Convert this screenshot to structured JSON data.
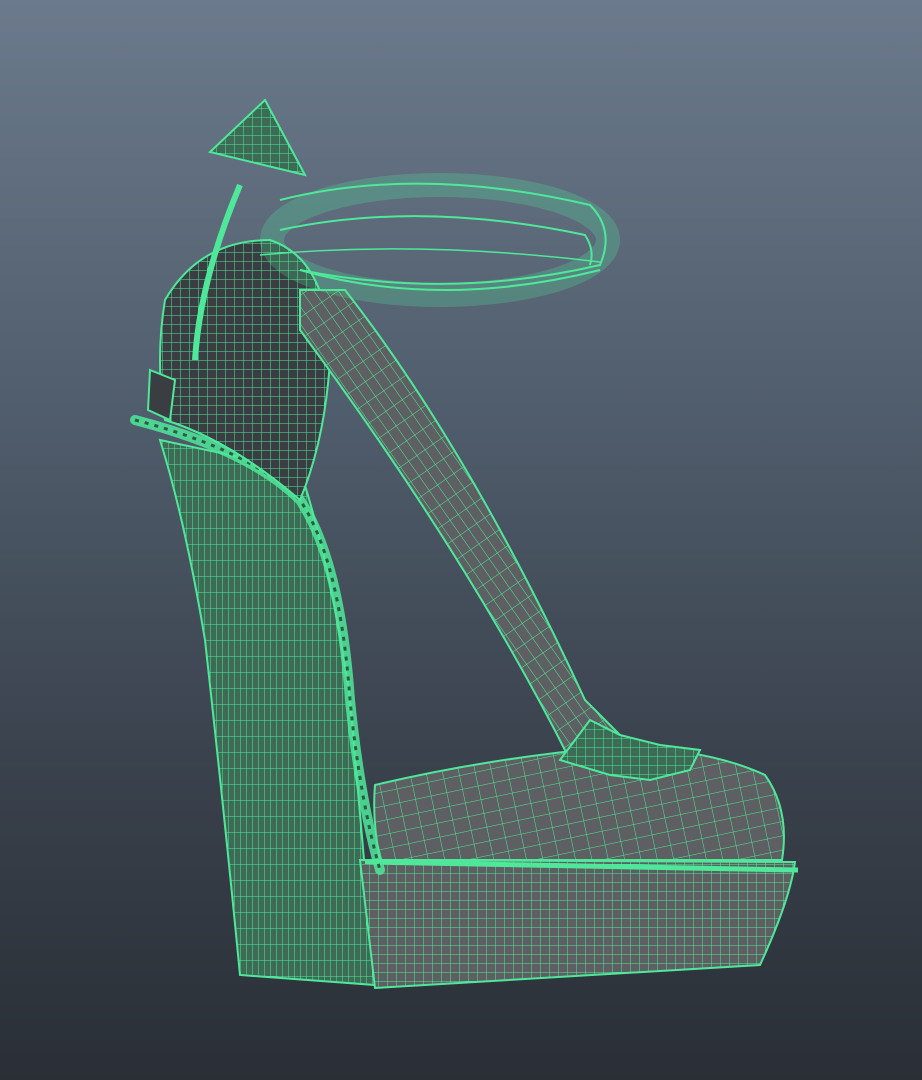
{
  "viewport": {
    "background_top": "#6b7a8c",
    "background_bottom": "#2a2f36"
  },
  "model": {
    "kind": "wedge-sandal-3d-mesh",
    "display_mode": "wireframe-on-shaded",
    "wire_color": "#4fe89a",
    "shade_color": "#5d5f62",
    "shade_dark_color": "#3a3d42"
  }
}
